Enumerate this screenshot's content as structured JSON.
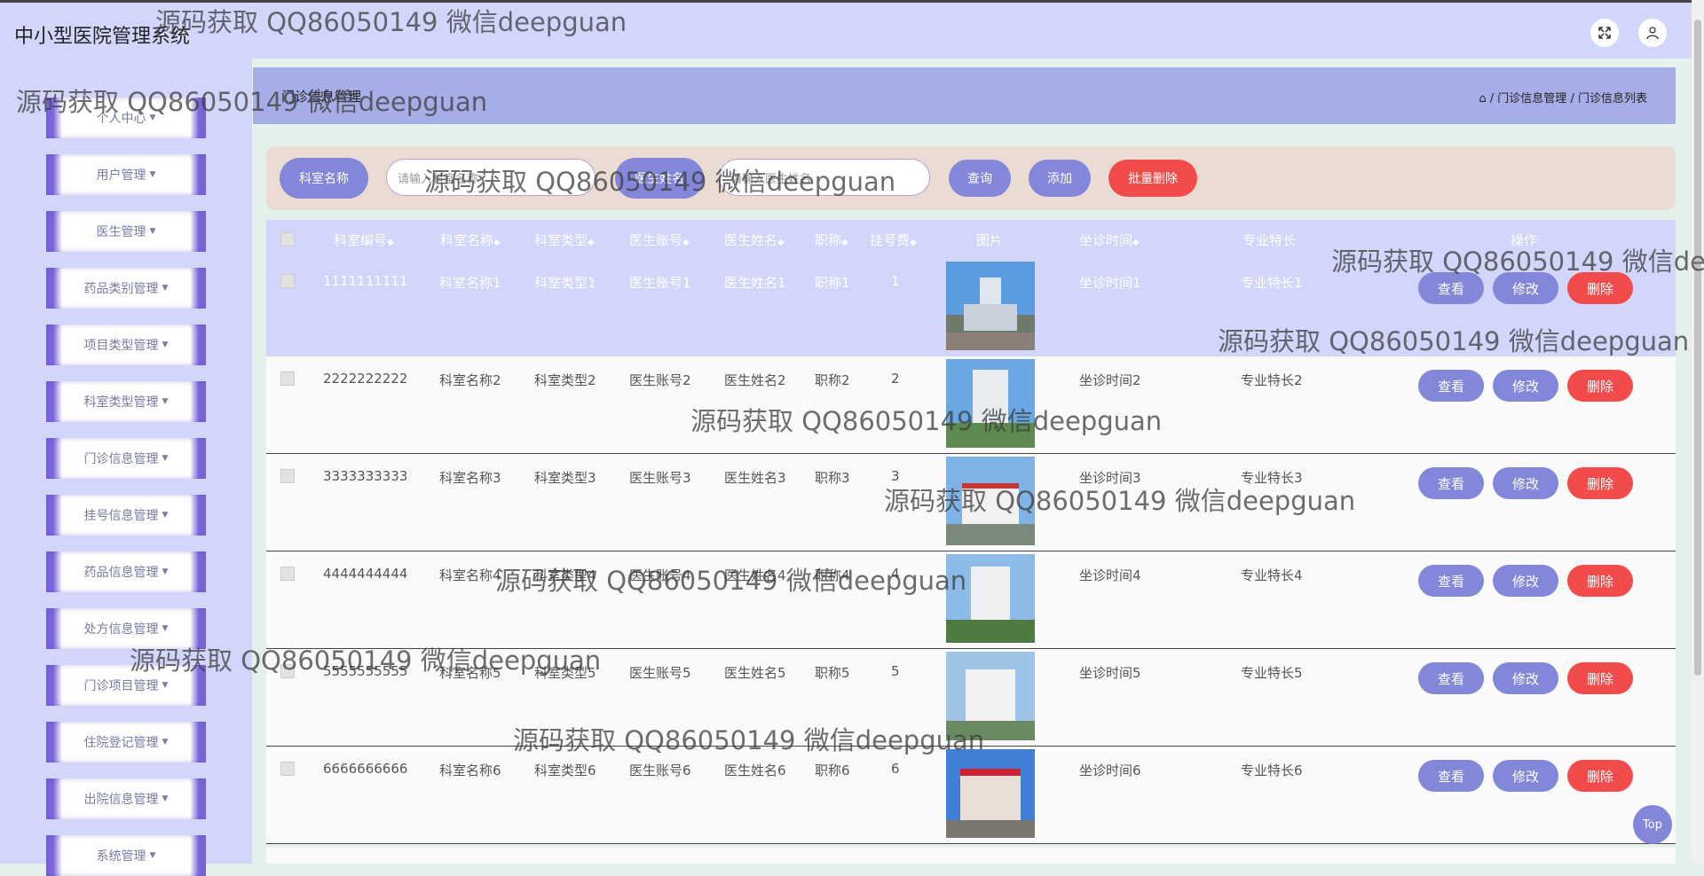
{
  "app": {
    "title": "中小型医院管理系统"
  },
  "topbar": {
    "fullscreen_icon": "expand-icon",
    "user_icon": "user-icon"
  },
  "sidebar": {
    "items": [
      {
        "label": "个人中心"
      },
      {
        "label": "用户管理"
      },
      {
        "label": "医生管理"
      },
      {
        "label": "药品类别管理"
      },
      {
        "label": "项目类型管理"
      },
      {
        "label": "科室类型管理"
      },
      {
        "label": "门诊信息管理"
      },
      {
        "label": "挂号信息管理"
      },
      {
        "label": "药品信息管理"
      },
      {
        "label": "处方信息管理"
      },
      {
        "label": "门诊项目管理"
      },
      {
        "label": "住院登记管理"
      },
      {
        "label": "出院信息管理"
      },
      {
        "label": "系统管理"
      }
    ]
  },
  "breadcrumb": {
    "title": "门诊信息管理",
    "home_icon": "home-icon",
    "path1": "门诊信息管理",
    "sep": "/",
    "path2": "门诊信息列表"
  },
  "search": {
    "label1": "科室名称",
    "placeholder1": "请输入科室名称",
    "label2": "医生姓名",
    "placeholder2": "请输入医生姓名",
    "query": "查询",
    "add": "添加",
    "batch_delete": "批量删除"
  },
  "table": {
    "headers": [
      "科室编号",
      "科室名称",
      "科室类型",
      "医生账号",
      "医生姓名",
      "职称",
      "挂号费",
      "图片",
      "坐诊时间",
      "专业特长",
      "操作"
    ],
    "rows": [
      {
        "id": "1111111111",
        "dept": "科室名称1",
        "type": "科室类型1",
        "account": "医生账号1",
        "doctor": "医生姓名1",
        "title": "职称1",
        "fee": "1",
        "time": "坐诊时间1",
        "specialty": "专业特长1"
      },
      {
        "id": "2222222222",
        "dept": "科室名称2",
        "type": "科室类型2",
        "account": "医生账号2",
        "doctor": "医生姓名2",
        "title": "职称2",
        "fee": "2",
        "time": "坐诊时间2",
        "specialty": "专业特长2"
      },
      {
        "id": "3333333333",
        "dept": "科室名称3",
        "type": "科室类型3",
        "account": "医生账号3",
        "doctor": "医生姓名3",
        "title": "职称3",
        "fee": "3",
        "time": "坐诊时间3",
        "specialty": "专业特长3"
      },
      {
        "id": "4444444444",
        "dept": "科室名称4",
        "type": "科室类型4",
        "account": "医生账号4",
        "doctor": "医生姓名4",
        "title": "职称4",
        "fee": "4",
        "time": "坐诊时间4",
        "specialty": "专业特长4"
      },
      {
        "id": "5555555555",
        "dept": "科室名称5",
        "type": "科室类型5",
        "account": "医生账号5",
        "doctor": "医生姓名5",
        "title": "职称5",
        "fee": "5",
        "time": "坐诊时间5",
        "specialty": "专业特长5"
      },
      {
        "id": "6666666666",
        "dept": "科室名称6",
        "type": "科室类型6",
        "account": "医生账号6",
        "doctor": "医生姓名6",
        "title": "职称6",
        "fee": "6",
        "time": "坐诊时间6",
        "specialty": "专业特长6"
      }
    ],
    "actions": {
      "view": "查看",
      "edit": "修改",
      "delete": "删除"
    }
  },
  "top_button": "Top",
  "watermark": "源码获取 QQ86050149 微信deepguan",
  "colors": {
    "accent": "#8287d9",
    "danger": "#f24b4b",
    "sidebar_bg": "#d3d6fb",
    "breadcrumb_bg": "#a6aee8",
    "search_bg": "#eadbd3"
  }
}
